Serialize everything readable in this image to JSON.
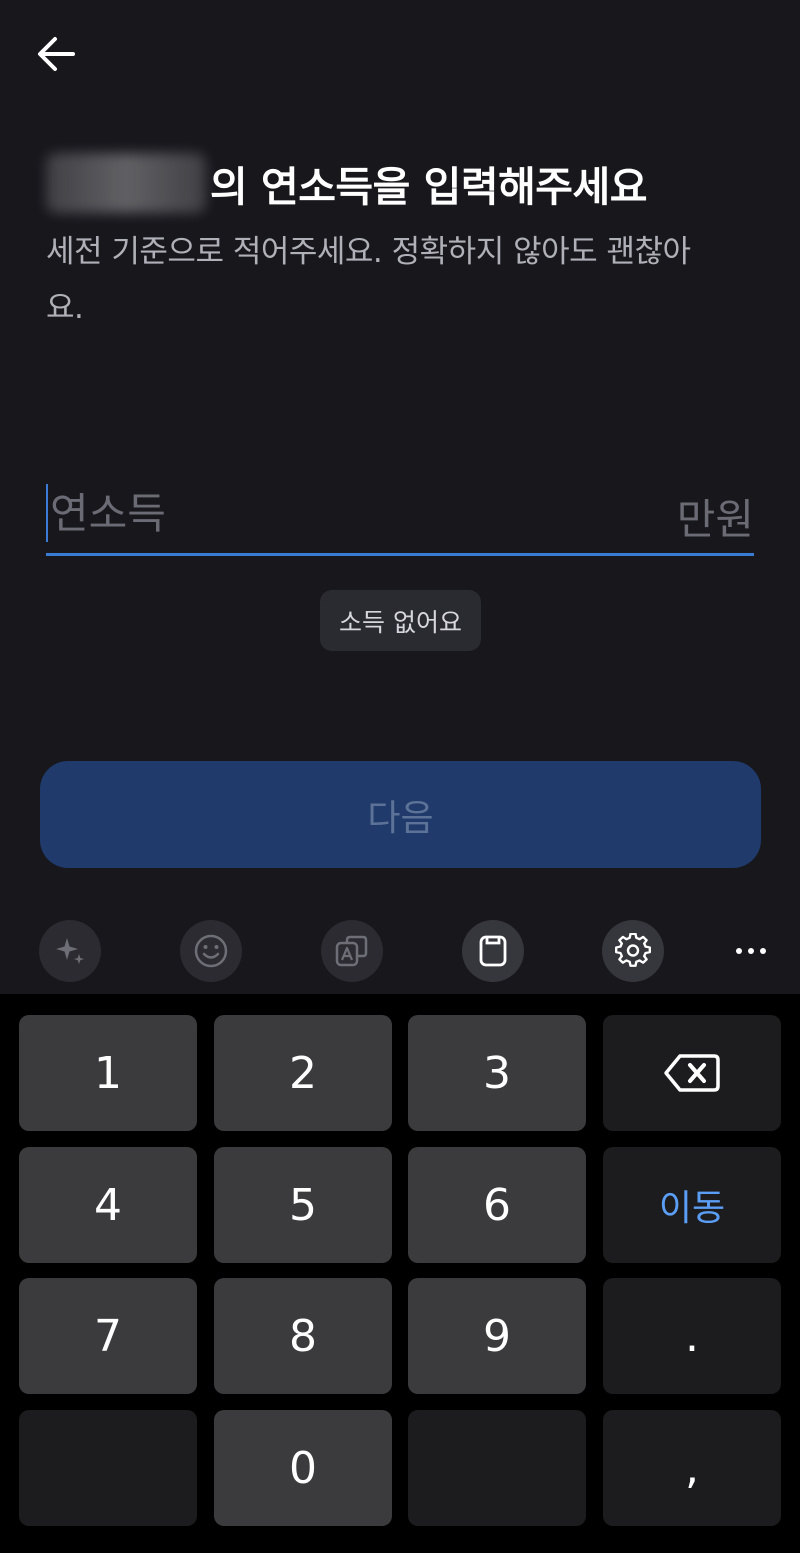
{
  "header": {
    "back_icon": "arrow-left-icon"
  },
  "title": {
    "suffix": "의 연소득을 입력해주세요"
  },
  "subtitle": "세전 기준으로 적어주세요. 정확하지 않아도 괜찮아요.",
  "income_field": {
    "placeholder": "연소득",
    "value": "",
    "unit": "만원"
  },
  "no_income_label": "소득 없어요",
  "next_label": "다음",
  "keyboard_toolbar": {
    "items": [
      "sparkle-icon",
      "emoji-icon",
      "translate-icon",
      "clipboard-icon",
      "gear-icon",
      "more-icon"
    ]
  },
  "keyboard": {
    "keys": [
      "1",
      "2",
      "3",
      "4",
      "5",
      "6",
      "7",
      "8",
      "9",
      "0",
      ".",
      ","
    ],
    "move_label": "이동",
    "backspace_icon": "backspace-icon"
  },
  "colors": {
    "background": "#17171c",
    "accent": "#3a7bd5",
    "next_button": "#1f3a6b"
  }
}
